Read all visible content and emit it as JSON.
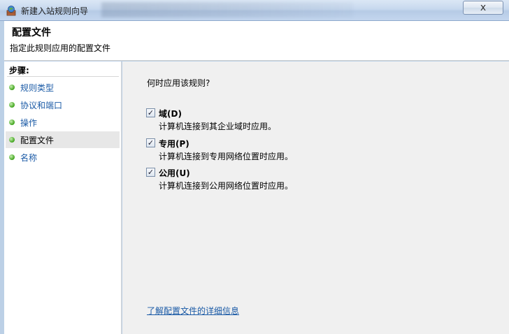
{
  "window": {
    "title": "新建入站规则向导",
    "close_symbol": "x"
  },
  "header": {
    "title": "配置文件",
    "subtitle": "指定此规则应用的配置文件"
  },
  "sidebar": {
    "steps_label": "步骤:",
    "items": [
      {
        "label": "规则类型",
        "active": false
      },
      {
        "label": "协议和端口",
        "active": false
      },
      {
        "label": "操作",
        "active": false
      },
      {
        "label": "配置文件",
        "active": true
      },
      {
        "label": "名称",
        "active": false
      }
    ]
  },
  "main": {
    "question": "何时应用该规则?",
    "options": [
      {
        "name": "域(D)",
        "description": "计算机连接到其企业域时应用。",
        "checked": true
      },
      {
        "name": "专用(P)",
        "description": "计算机连接到专用网络位置时应用。",
        "checked": true
      },
      {
        "name": "公用(U)",
        "description": "计算机连接到公用网络位置时应用。",
        "checked": true
      }
    ],
    "learn_more": "了解配置文件的详细信息"
  }
}
